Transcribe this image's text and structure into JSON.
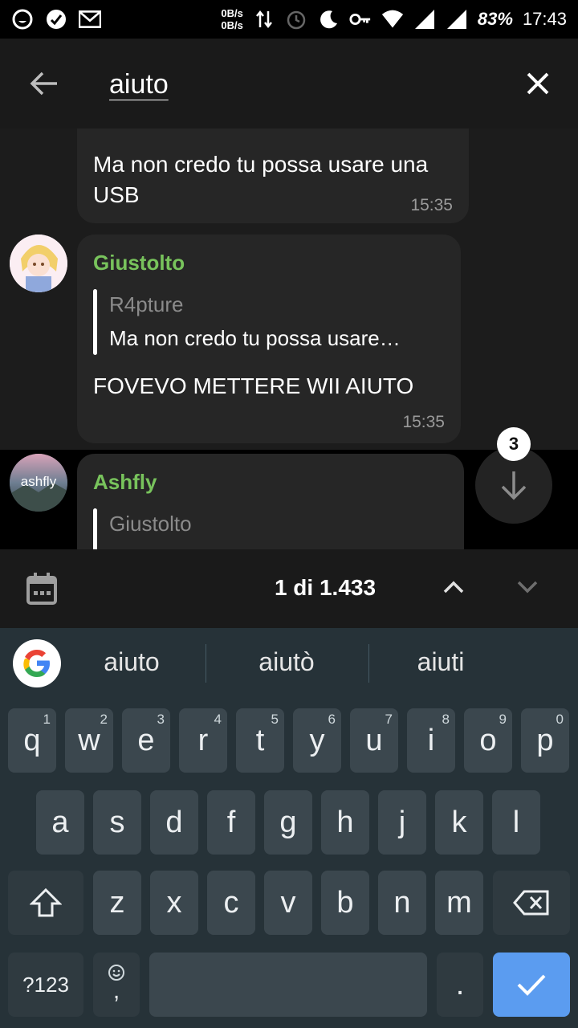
{
  "status_bar": {
    "net_up": "0B/s",
    "net_down": "0B/s",
    "battery": "83%",
    "time": "17:43",
    "icons": [
      "whatsapp-icon",
      "check-circle-icon",
      "gmail-icon",
      "data-transfer-icon",
      "alarm-icon",
      "moon-icon",
      "key-icon",
      "wifi-icon",
      "signal-icon",
      "signal-icon-2"
    ]
  },
  "header": {
    "search_value": "aiuto",
    "icons": [
      "back-arrow-icon",
      "close-icon"
    ]
  },
  "messages": [
    {
      "text": "Ma non credo tu possa usare una USB",
      "time": "15:35"
    },
    {
      "sender": "Giustolto",
      "reply_name": "R4pture",
      "reply_text": "Ma non credo tu possa usare…",
      "text": "FOVEVO METTERE WII AIUTO",
      "time": "15:35"
    },
    {
      "sender": "Ashfly",
      "avatar_text": "ashfly",
      "reply_name": "Giustolto"
    }
  ],
  "scroll_down": {
    "badge": "3"
  },
  "search_nav": {
    "count": "1 di 1.433",
    "icons": [
      "calendar-icon",
      "chevron-up-icon",
      "chevron-down-icon"
    ]
  },
  "keyboard": {
    "suggestions": [
      "aiuto",
      "aiutò",
      "aiuti"
    ],
    "row1": [
      {
        "k": "q",
        "h": "1"
      },
      {
        "k": "w",
        "h": "2"
      },
      {
        "k": "e",
        "h": "3"
      },
      {
        "k": "r",
        "h": "4"
      },
      {
        "k": "t",
        "h": "5"
      },
      {
        "k": "y",
        "h": "6"
      },
      {
        "k": "u",
        "h": "7"
      },
      {
        "k": "i",
        "h": "8"
      },
      {
        "k": "o",
        "h": "9"
      },
      {
        "k": "p",
        "h": "0"
      }
    ],
    "row2": [
      "a",
      "s",
      "d",
      "f",
      "g",
      "h",
      "j",
      "k",
      "l"
    ],
    "row3": [
      "z",
      "x",
      "c",
      "v",
      "b",
      "n",
      "m"
    ],
    "symbols_label": "?123",
    "comma_label": ",",
    "period_label": ".",
    "accent_color": "#5b9cf0"
  }
}
